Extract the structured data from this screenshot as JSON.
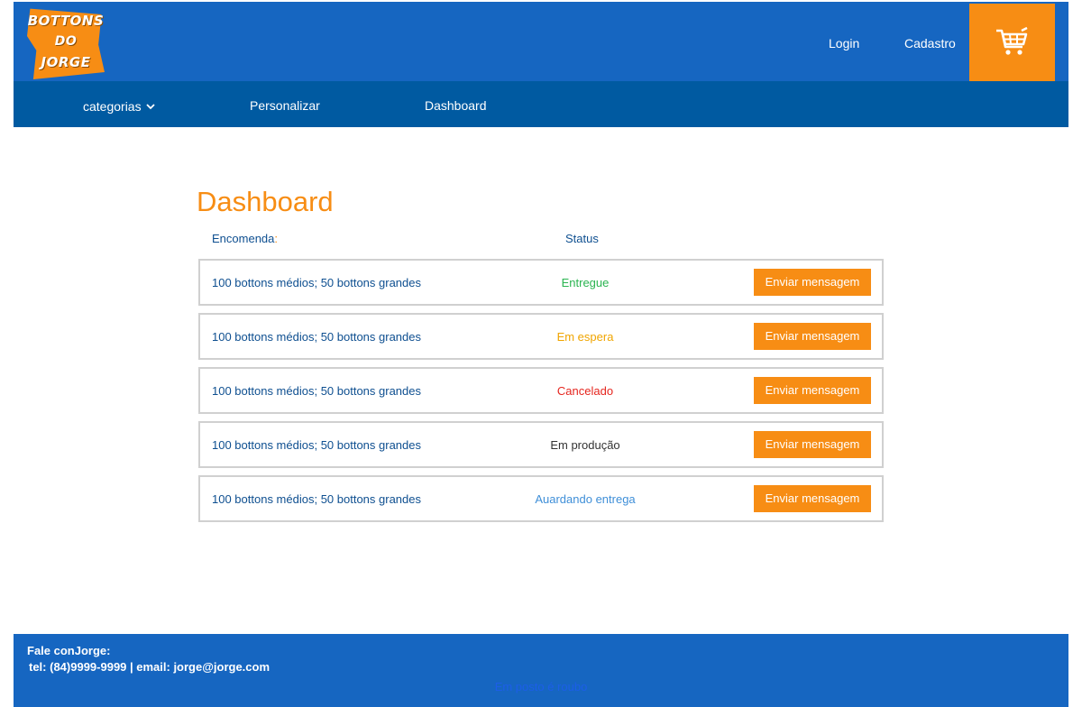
{
  "header": {
    "logo": {
      "line1": "BOTTONS",
      "line2": "DO",
      "line3": "JORGE"
    },
    "login_label": "Login",
    "cadastro_label": "Cadastro",
    "cart_icon": "shopping-cart-icon"
  },
  "nav": {
    "categorias_label": "categorias",
    "personalizar_label": "Personalizar",
    "dashboard_label": "Dashboard"
  },
  "main": {
    "title": "Dashboard",
    "col_encomenda": "Encomenda",
    "col_encomenda_colon": ":",
    "col_status": "Status",
    "orders": [
      {
        "description": "100 bottons médios; 50 bottons grandes",
        "status": "Entregue",
        "status_color": "#2ab450",
        "button": "Enviar mensagem"
      },
      {
        "description": "100 bottons médios; 50 bottons grandes",
        "status": "Em espera",
        "status_color": "#f0a500",
        "button": "Enviar mensagem"
      },
      {
        "description": "100 bottons médios; 50 bottons grandes",
        "status": "Cancelado",
        "status_color": "#e5251e",
        "button": "Enviar mensagem"
      },
      {
        "description": "100 bottons médios; 50 bottons grandes",
        "status": "Em produção",
        "status_color": "#333333",
        "button": "Enviar mensagem"
      },
      {
        "description": "100 bottons médios; 50 bottons grandes",
        "status": "Auardando entrega",
        "status_color": "#3f8fd8",
        "button": "Enviar mensagem"
      }
    ]
  },
  "footer": {
    "contact_title": "Fale conJorge:",
    "contact_line": "tel: (84)9999-9999 | email: jorge@jorge.com",
    "slogan": "Em posto é roubo"
  },
  "colors": {
    "header_blue": "#1666c1",
    "nav_blue": "#005aa1",
    "accent_orange": "#f78d14",
    "text_blue": "#0e4f90"
  }
}
